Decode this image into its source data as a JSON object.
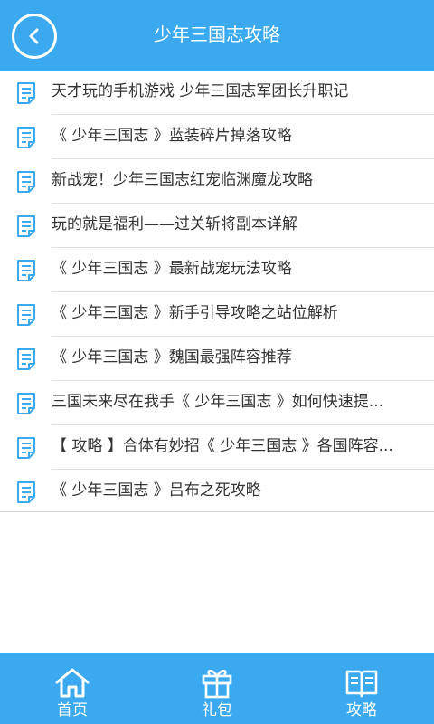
{
  "header": {
    "title": "少年三国志攻略",
    "back_icon": "chevron-left-icon"
  },
  "articles": [
    {
      "title": "天才玩的手机游戏 少年三国志军团长升职记"
    },
    {
      "title": "《 少年三国志 》蓝装碎片掉落攻略"
    },
    {
      "title": "新战宠！少年三国志红宠临渊魔龙攻略"
    },
    {
      "title": "玩的就是福利——过关斩将副本详解"
    },
    {
      "title": "《 少年三国志 》最新战宠玩法攻略"
    },
    {
      "title": "《 少年三国志 》新手引导攻略之站位解析"
    },
    {
      "title": "《 少年三国志 》魏国最强阵容推荐"
    },
    {
      "title": "三国未来尽在我手《 少年三国志 》如何快速提..."
    },
    {
      "title": "【 攻略 】合体有妙招《 少年三国志 》各国阵容..."
    },
    {
      "title": "《 少年三国志 》吕布之死攻略"
    }
  ],
  "tabbar": {
    "tabs": [
      {
        "label": "首页",
        "icon": "home-icon"
      },
      {
        "label": "礼包",
        "icon": "gift-icon"
      },
      {
        "label": "攻略",
        "icon": "book-icon"
      }
    ]
  },
  "colors": {
    "primary": "#3aa9ef",
    "text": "#333333",
    "divider": "#e0e0e0"
  }
}
